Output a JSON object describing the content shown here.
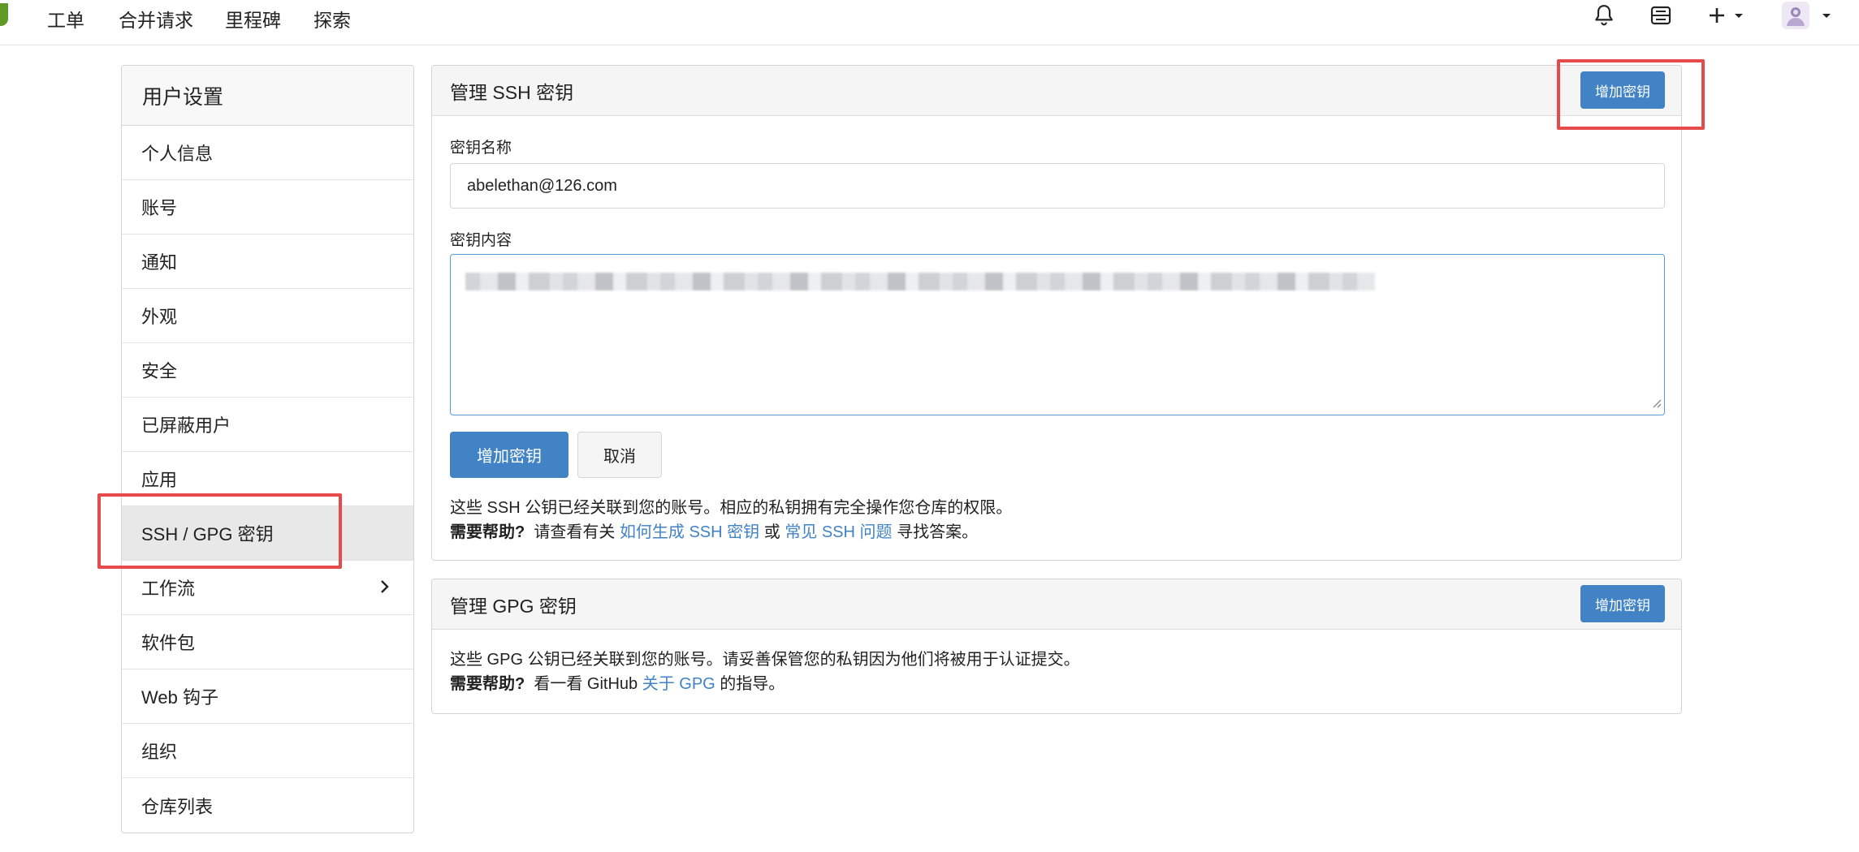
{
  "nav": {
    "items": [
      "工单",
      "合并请求",
      "里程碑",
      "探索"
    ],
    "icons": [
      "bell-icon",
      "inbox-icon",
      "plus-icon",
      "avatar"
    ],
    "brand_color": "#609926"
  },
  "sidebar": {
    "title": "用户设置",
    "items": [
      {
        "label": "个人信息"
      },
      {
        "label": "账号"
      },
      {
        "label": "通知"
      },
      {
        "label": "外观"
      },
      {
        "label": "安全"
      },
      {
        "label": "已屏蔽用户"
      },
      {
        "label": "应用"
      },
      {
        "label": "SSH / GPG 密钥",
        "active": true
      },
      {
        "label": "工作流",
        "has_chevron": true
      },
      {
        "label": "软件包"
      },
      {
        "label": "Web 钩子"
      },
      {
        "label": "组织"
      },
      {
        "label": "仓库列表"
      }
    ]
  },
  "ssh": {
    "title": "管理 SSH 密钥",
    "add_button": "增加密钥",
    "name_label": "密钥名称",
    "name_value": "abelethan@126.com",
    "content_label": "密钥内容",
    "submit_button": "增加密钥",
    "cancel_button": "取消",
    "desc": "这些 SSH 公钥已经关联到您的账号。相应的私钥拥有完全操作您仓库的权限。",
    "help_bold": "需要帮助?",
    "help_pre": "请查看有关",
    "help_link1": "如何生成 SSH 密钥",
    "help_mid": "或",
    "help_link2": "常见 SSH 问题",
    "help_post": "寻找答案。"
  },
  "gpg": {
    "title": "管理 GPG 密钥",
    "add_button": "增加密钥",
    "desc": "这些 GPG 公钥已经关联到您的账号。请妥善保管您的私钥因为他们将被用于认证提交。",
    "help_bold": "需要帮助?",
    "help_pre": "看一看 GitHub",
    "help_link": "关于 GPG",
    "help_post": "的指导。"
  },
  "colors": {
    "primary": "#4183c4",
    "annotation": "#e54b4b"
  }
}
